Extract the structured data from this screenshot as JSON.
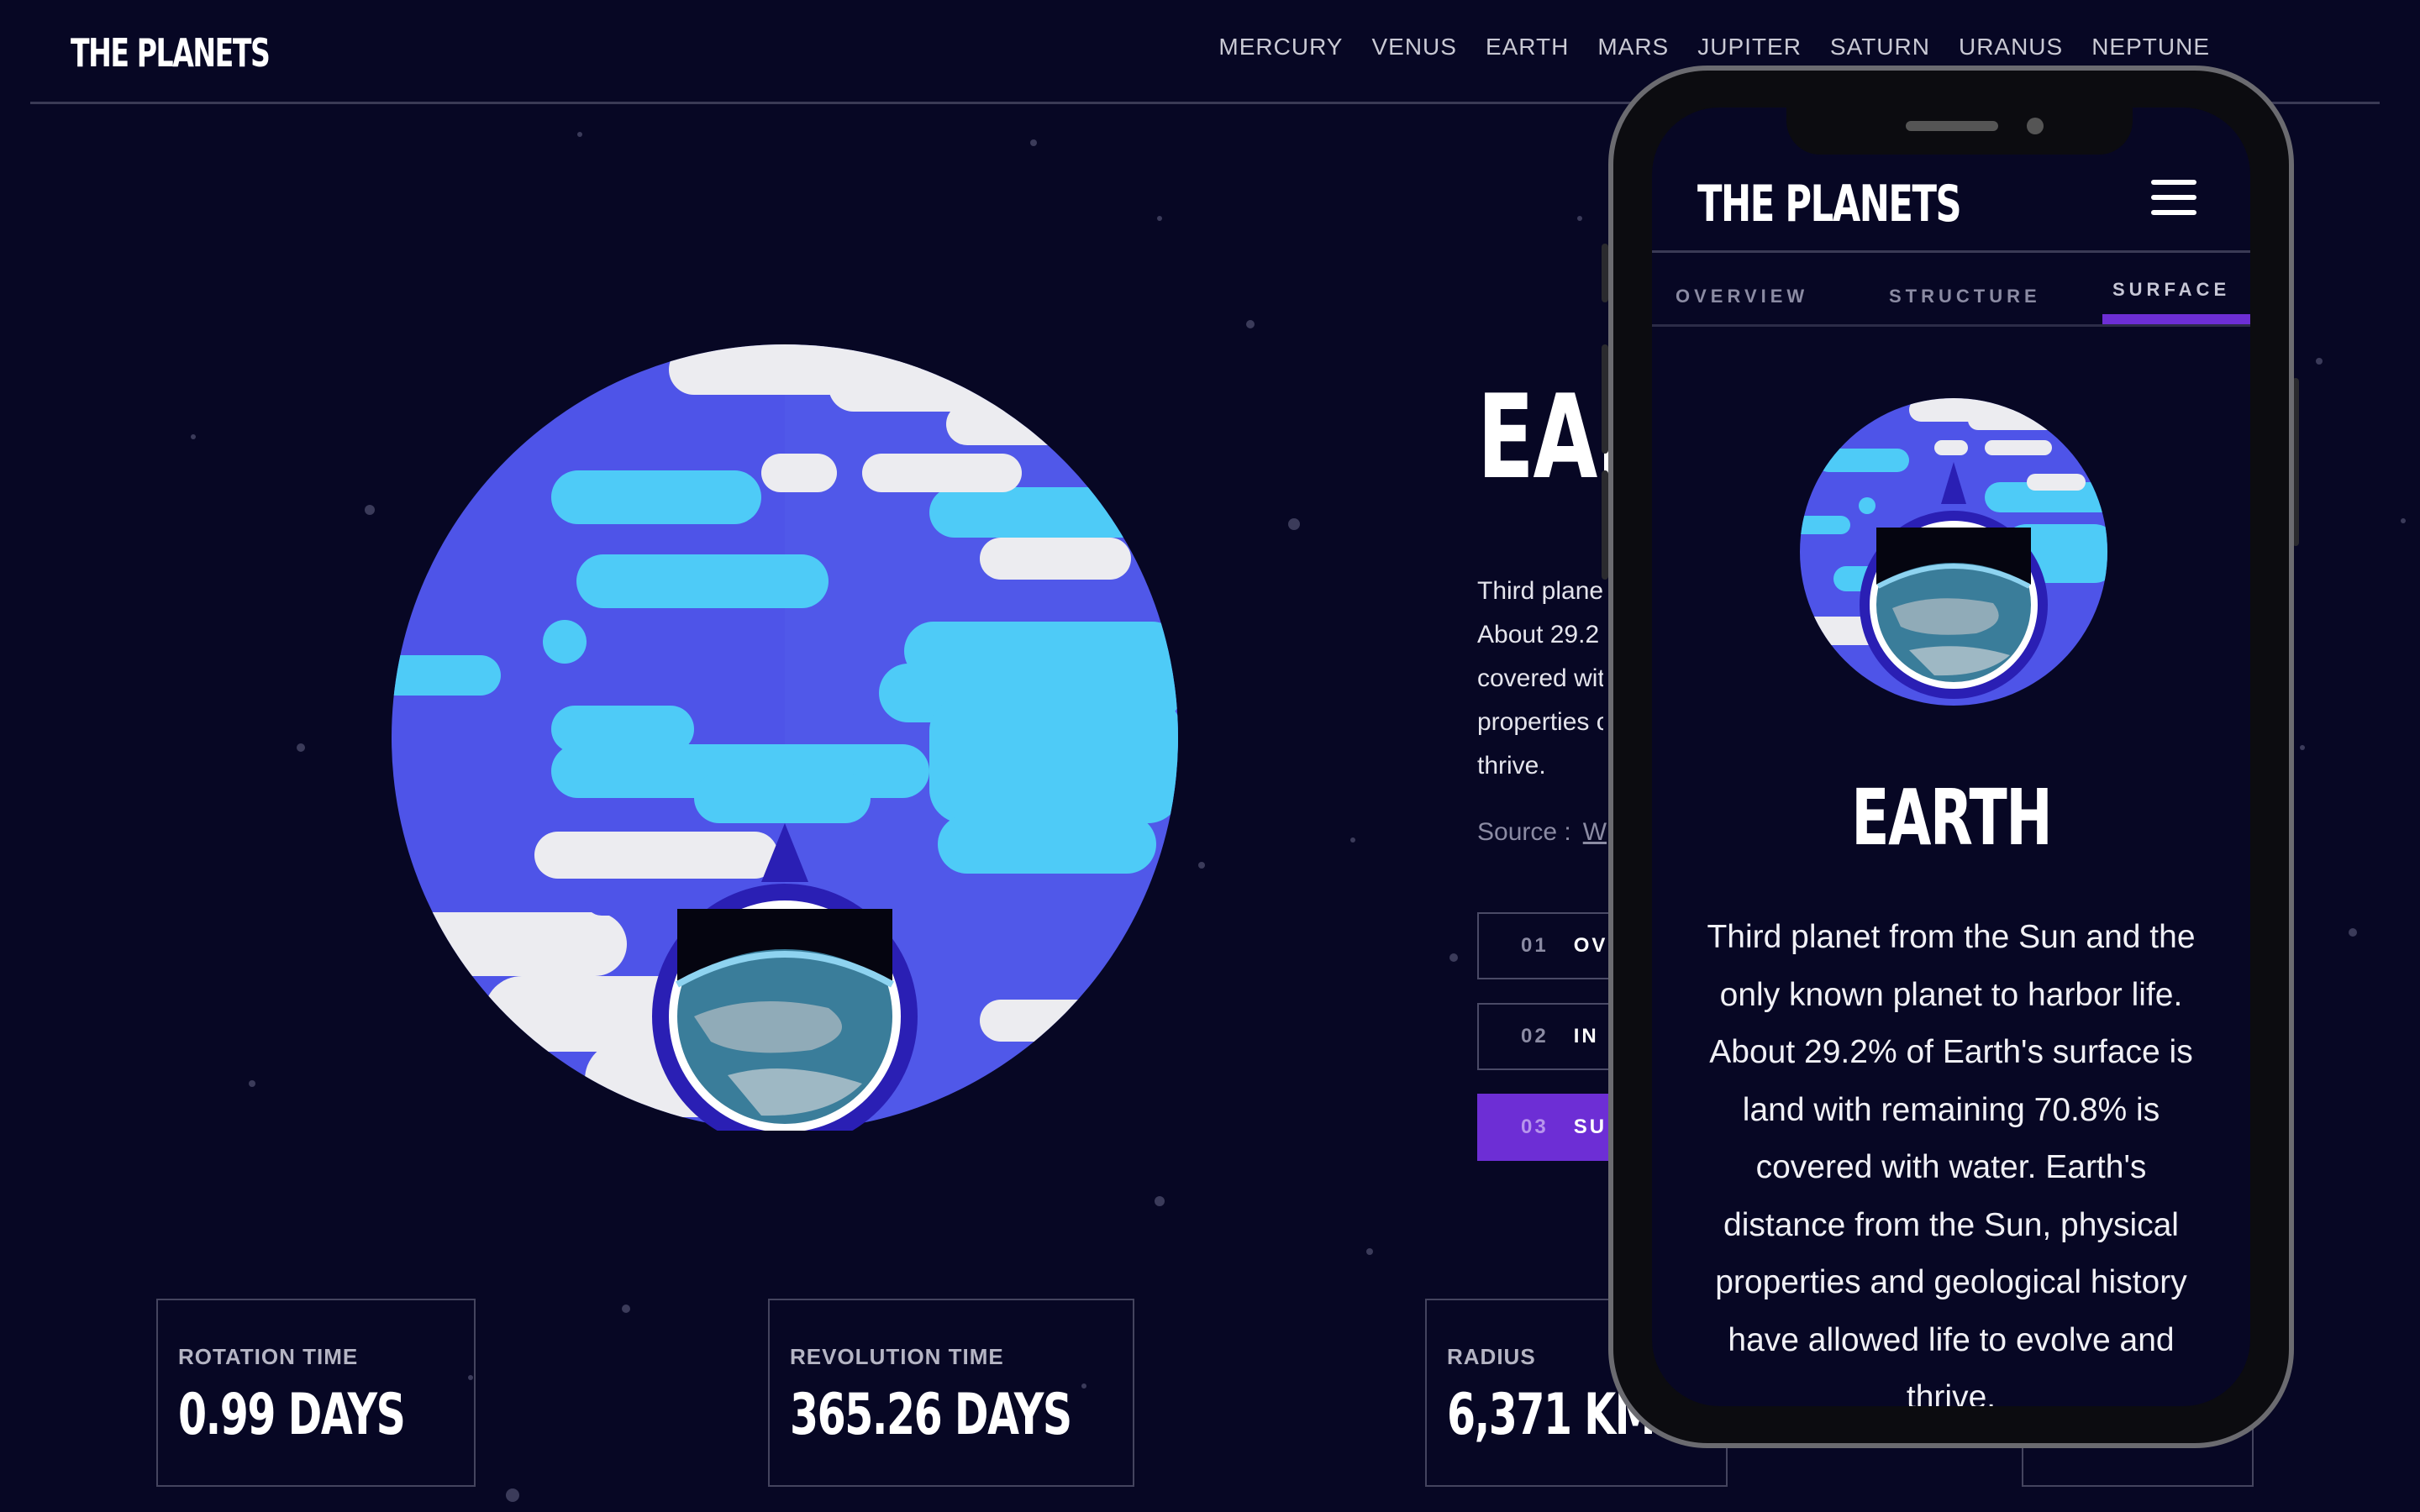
{
  "brand": "THE PLANETS",
  "nav": [
    "MERCURY",
    "VENUS",
    "EARTH",
    "MARS",
    "JUPITER",
    "SATURN",
    "URANUS",
    "NEPTUNE"
  ],
  "planet": {
    "name": "EARTH",
    "desktop_title_visible": "EAR",
    "desktop_description_lines": [
      "Third plane",
      "About 29.2",
      "covered wit",
      "properties c",
      "thrive."
    ],
    "source_label": "Source :",
    "source_link": "W",
    "tabs": [
      {
        "num": "01",
        "label": "OV"
      },
      {
        "num": "02",
        "label": "IN"
      },
      {
        "num": "03",
        "label": "SU"
      }
    ]
  },
  "stats": [
    {
      "label": "ROTATION TIME",
      "value": "0.99 DAYS"
    },
    {
      "label": "REVOLUTION TIME",
      "value": "365.26 DAYS"
    },
    {
      "label": "RADIUS",
      "value": "6,371 KM"
    }
  ],
  "mobile": {
    "brand": "THE PLANETS",
    "tabs": [
      "OVERVIEW",
      "STRUCTURE",
      "SURFACE"
    ],
    "active_tab": "SURFACE",
    "title": "EARTH",
    "description_lines": [
      "Third planet from the Sun and the",
      "only known planet to harbor life.",
      "About 29.2% of Earth's surface is",
      "land with remaining 70.8% is",
      "covered with water. Earth's",
      "distance from the Sun, physical",
      "properties and geological history",
      "have allowed life to evolve and",
      "thrive."
    ]
  },
  "colors": {
    "background": "#070724",
    "accent": "#6d2ed5",
    "planet_ocean": "#4e54e8",
    "planet_land": "#4ecbf7",
    "planet_cloud": "#ececf0"
  }
}
